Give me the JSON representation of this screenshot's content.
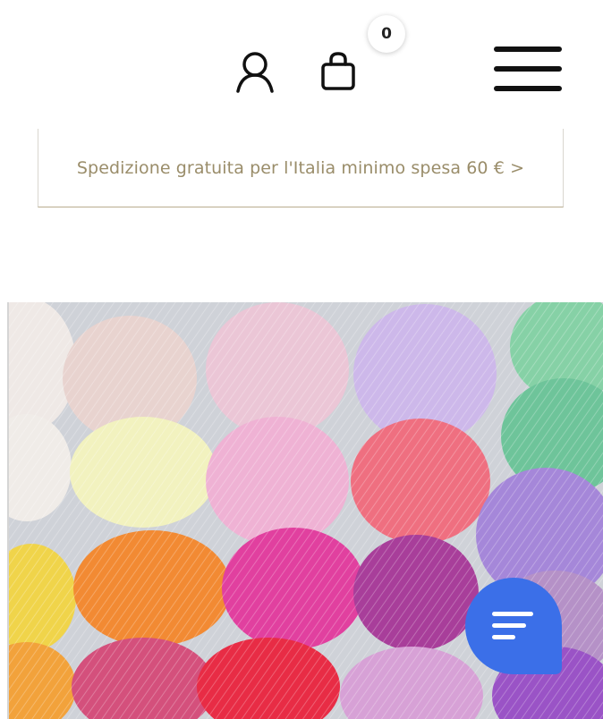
{
  "header": {
    "account_icon": "user-icon",
    "cart_icon": "shopping-bag-icon",
    "cart_count": "0",
    "menu_icon": "hamburger-menu-icon"
  },
  "promo": {
    "text": "Spedizione gratuita per l'Italia minimo spesa 60 € >"
  },
  "hero": {
    "image": "colorful-yarn-balls-photo"
  },
  "chat": {
    "icon": "chat-bubble-icon",
    "color": "#3b6fe8"
  },
  "colors": {
    "promo_text": "#9a8d6a",
    "promo_border": "#b9ad8e"
  }
}
